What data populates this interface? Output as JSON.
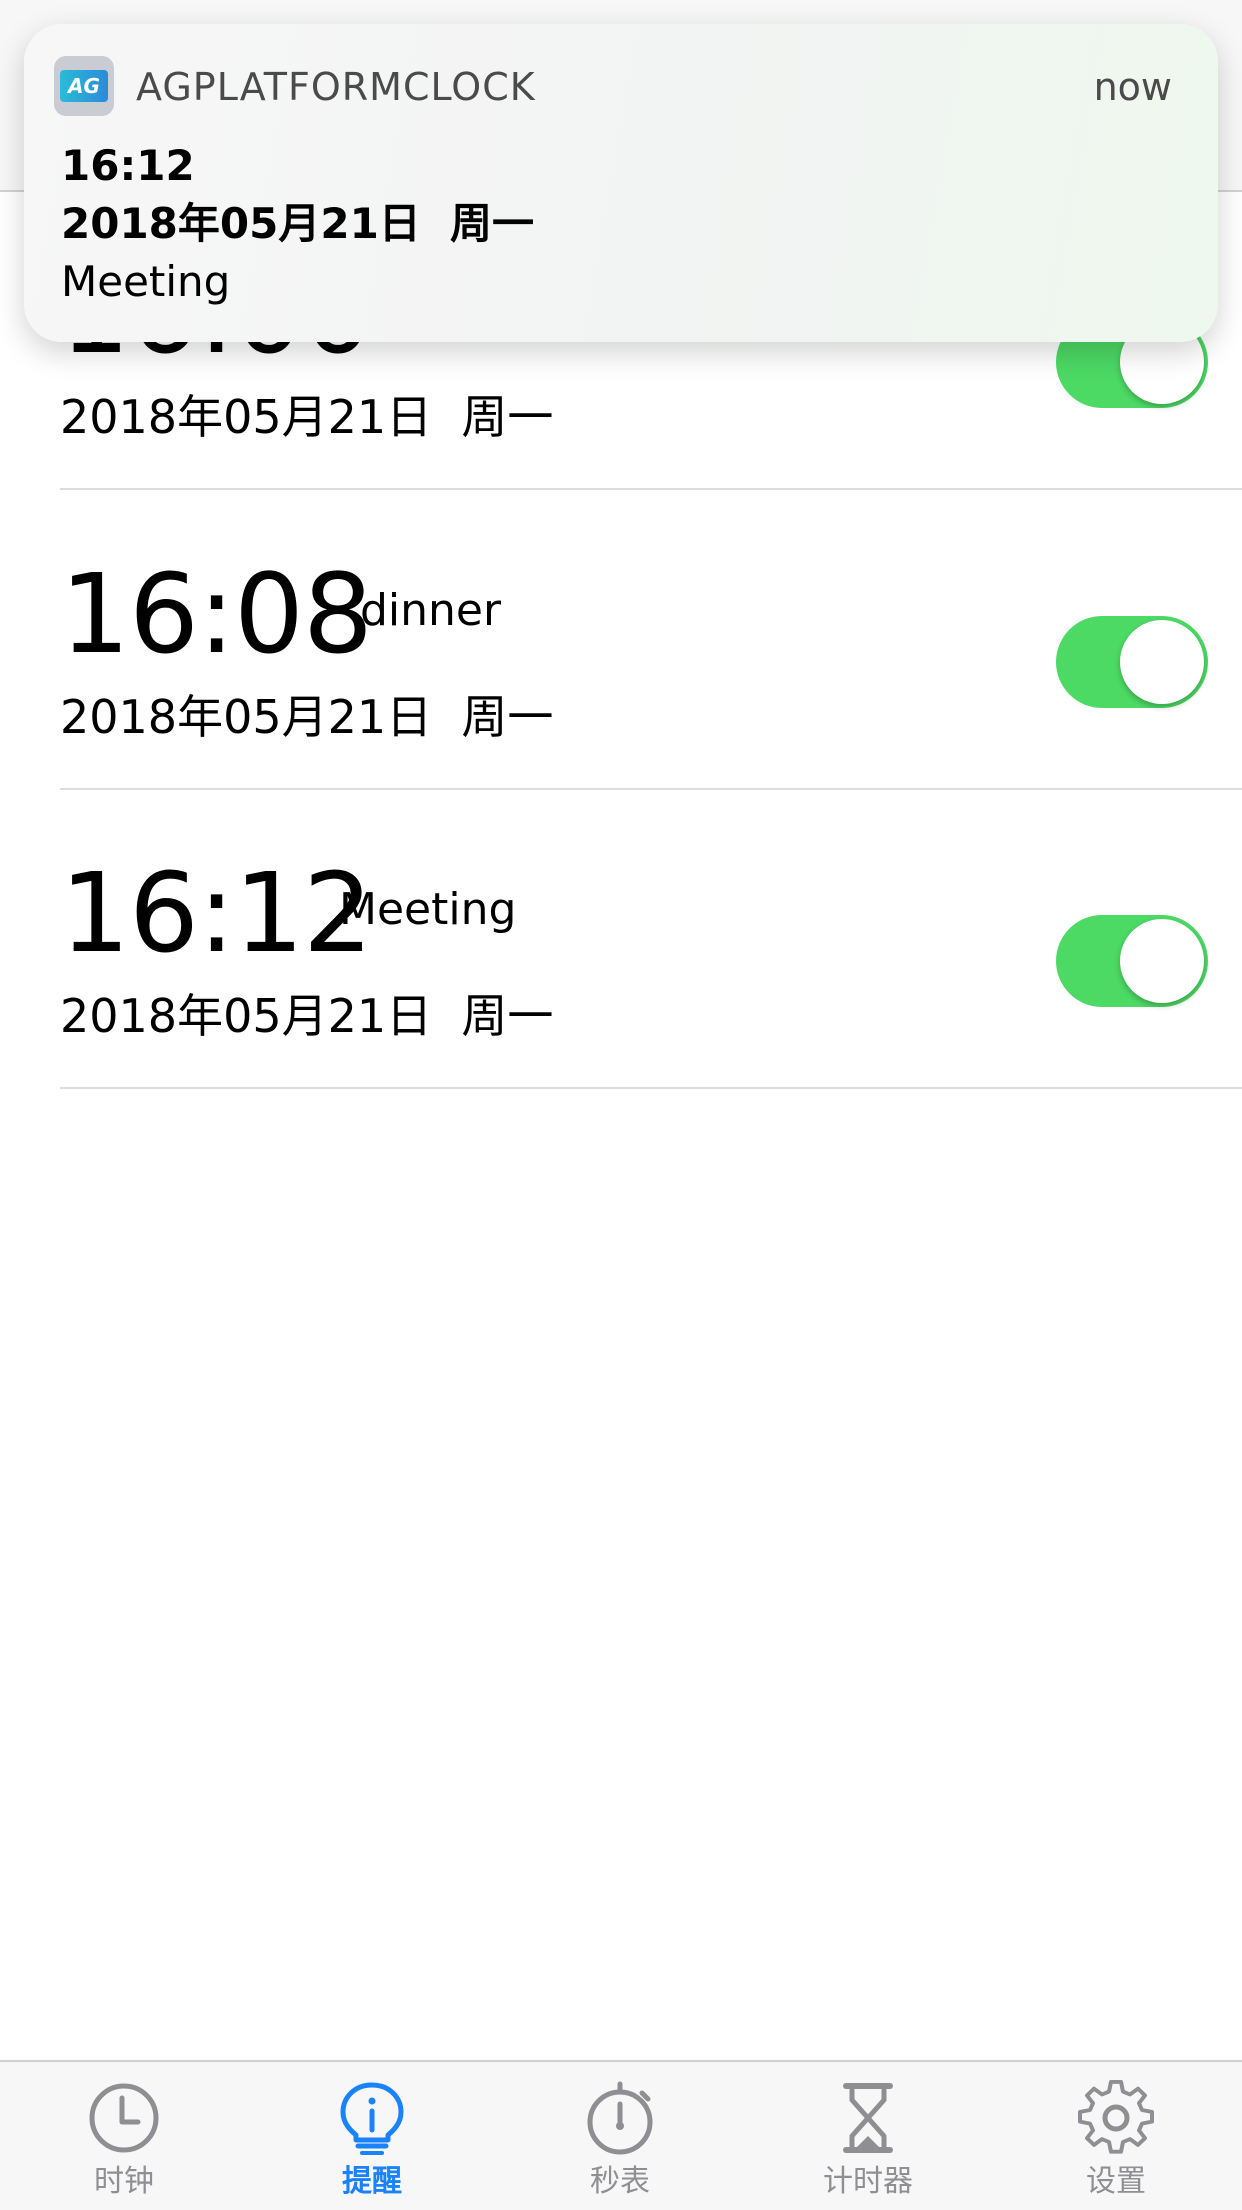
{
  "notification": {
    "app_name": "AGPLATFORMCLOCK",
    "app_icon_text": "AG",
    "time_label": "now",
    "title": "16:12",
    "subtitle": "2018年05月21日  周一",
    "body": "Meeting"
  },
  "alarms": [
    {
      "time": "16:00",
      "label": "",
      "date": "2018年05月21日  周一",
      "enabled": true
    },
    {
      "time": "16:08",
      "label": "dinner",
      "date": "2018年05月21日  周一",
      "enabled": true
    },
    {
      "time": "16:12",
      "label": "Meeting",
      "date": "2018年05月21日  周一",
      "enabled": true
    }
  ],
  "tabbar": {
    "items": [
      {
        "label": "时钟",
        "icon": "clock-icon",
        "active": false
      },
      {
        "label": "提醒",
        "icon": "lightbulb-icon",
        "active": true
      },
      {
        "label": "秒表",
        "icon": "stopwatch-icon",
        "active": false
      },
      {
        "label": "计时器",
        "icon": "hourglass-icon",
        "active": false
      },
      {
        "label": "设置",
        "icon": "gear-icon",
        "active": false
      }
    ]
  },
  "colors": {
    "toggle_on": "#4cd964",
    "tab_active": "#1a82fb",
    "tab_inactive": "#8e8e93"
  }
}
